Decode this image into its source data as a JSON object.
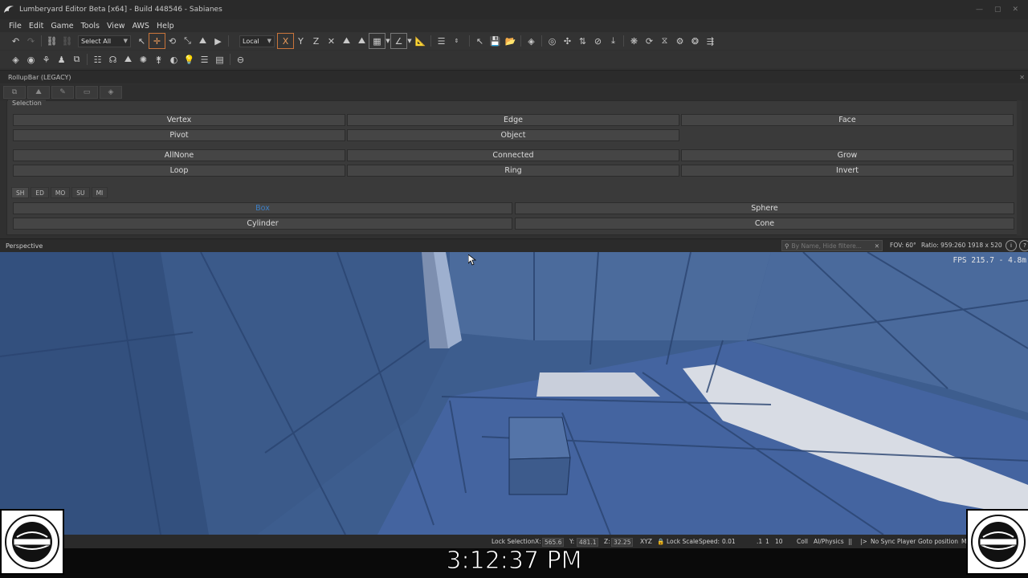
{
  "window": {
    "title": "Lumberyard Editor Beta [x64] - Build 448546 - Sabianes",
    "controls": [
      "minimize-icon",
      "maximize-icon",
      "close-icon"
    ]
  },
  "menu": [
    "File",
    "Edit",
    "Game",
    "Tools",
    "View",
    "AWS",
    "Help"
  ],
  "toolbar": {
    "select_filter": "Select All",
    "coord_space": "Local",
    "axis_x": "X",
    "axis_y": "Y",
    "axis_z": "Z"
  },
  "rollup": {
    "title": "RollupBar (LEGACY)",
    "section_label": "Selection",
    "selection_buttons": {
      "vertex": "Vertex",
      "edge": "Edge",
      "face": "Face",
      "pivot": "Pivot",
      "object": "Object",
      "allnone": "AllNone",
      "connected": "Connected",
      "grow": "Grow",
      "loop": "Loop",
      "ring": "Ring",
      "invert": "Invert"
    },
    "subtabs": [
      "SH",
      "ED",
      "MO",
      "SU",
      "MI"
    ],
    "shape_buttons": {
      "box": "Box",
      "sphere": "Sphere",
      "cylinder": "Cylinder",
      "cone": "Cone"
    }
  },
  "viewport": {
    "title": "Perspective",
    "search_placeholder": "By Name, Hide filtere...",
    "fov": "FOV: 60°",
    "ratio": "Ratio: 959:260",
    "resolution": "1918 x 520",
    "fps": "FPS 215.7 - 4.8m"
  },
  "status": {
    "lock_selection": "Lock Selection",
    "x_label": "X:",
    "x_value": "565.6",
    "y_label": "Y:",
    "y_value": "481.1",
    "z_label": "Z:",
    "z_value": "32.25",
    "xyz": "XYZ",
    "lock_scale": "Lock Scale",
    "speed_label": "Speed:",
    "speed_value": "0.01",
    "speed_presets": [
      ".1",
      "1",
      "10"
    ],
    "coll": "Coll",
    "ai_physics": "AI/Physics",
    "pause": "||",
    "step": "|>",
    "sync_player": "No Sync Player",
    "goto_position": "Goto position",
    "more": "M"
  },
  "clock": "3:12:37 PM"
}
